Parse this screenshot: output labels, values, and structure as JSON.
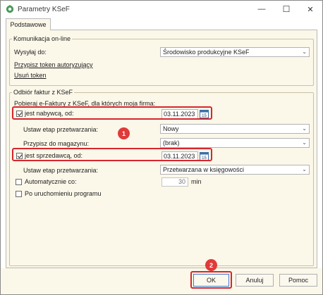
{
  "window": {
    "title": "Parametry KSeF",
    "minimize_label": "—",
    "maximize_label": "☐",
    "close_label": "✕"
  },
  "tabs": [
    {
      "label": "Podstawowe",
      "active": true
    }
  ],
  "online": {
    "title": "Komunikacja on-line",
    "send_to_label": "Wysyłaj do:",
    "send_to_value": "Środowisko produkcyjne KSeF",
    "assign_token_link": "Przypisz token autoryzujący",
    "remove_token_link": "Usuń token"
  },
  "receive": {
    "title": "Odbiór faktur z KSeF",
    "intro_label": "Pobieraj e-Faktury z KSeF, dla których moja firma:",
    "buyer": {
      "checkbox_label": "jest nabywcą, od:",
      "checked": true,
      "date": "03.11.2023",
      "stage_label": "Ustaw etap przetwarzania:",
      "stage_value": "Nowy",
      "warehouse_label": "Przypisz do magazynu:",
      "warehouse_value": "(brak)"
    },
    "seller": {
      "checkbox_label": "jest sprzedawcą, od:",
      "checked": true,
      "date": "03.11.2023",
      "stage_label": "Ustaw etap przetwarzania:",
      "stage_value": "Przetwarzana w księgowości"
    },
    "auto": {
      "label": "Automatycznie co:",
      "checked": false,
      "value": "30",
      "unit": "min"
    },
    "on_start": {
      "label": "Po uruchomieniu programu",
      "checked": false
    }
  },
  "calendar_icon_text": "15",
  "annotations": {
    "badge1": "1",
    "badge2": "2"
  },
  "buttons": {
    "ok": "OK",
    "cancel": "Anuluj",
    "help": "Pomoc"
  },
  "colors": {
    "panel_bg": "#fbf7e9",
    "highlight": "#d7262d",
    "badge": "#e03a3a"
  }
}
